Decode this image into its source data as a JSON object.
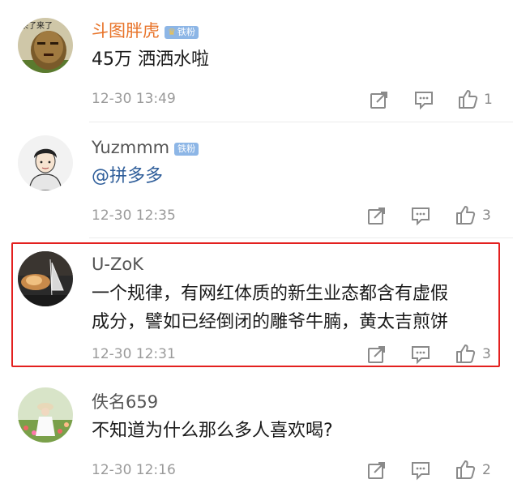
{
  "comments": [
    {
      "name": "斗图胖虎",
      "name_color": "#e8742a",
      "badge": "铁粉",
      "badge_crown": true,
      "text": "45万  洒洒水啦",
      "time": "12-30 13:49",
      "likes": "1"
    },
    {
      "name": "Yuzmmm",
      "name_color": "#555555",
      "badge": "铁粉",
      "badge_crown": false,
      "text": "@拼多多",
      "time": "12-30 12:35",
      "likes": "3"
    },
    {
      "name": "U-ZoK",
      "name_color": "#555555",
      "badge": "",
      "text_line1": "一个规律，有网红体质的新生业态都含有虚假",
      "text_line2": "成分，譬如已经倒闭的雕爷牛腩，黄太吉煎饼",
      "time": "12-30 12:31",
      "likes": "3",
      "highlighted": true,
      "highlight_color": "#e3201f"
    },
    {
      "name": "佚名659",
      "name_color": "#555555",
      "badge": "",
      "text": "不知道为什么那么多人喜欢喝?",
      "time": "12-30 12:16",
      "likes": "2"
    }
  ],
  "avatar_texts": {
    "c0": "来了来了"
  },
  "icons": {
    "share": "share-icon",
    "reply": "comment-icon",
    "like": "thumbs-up-icon"
  }
}
